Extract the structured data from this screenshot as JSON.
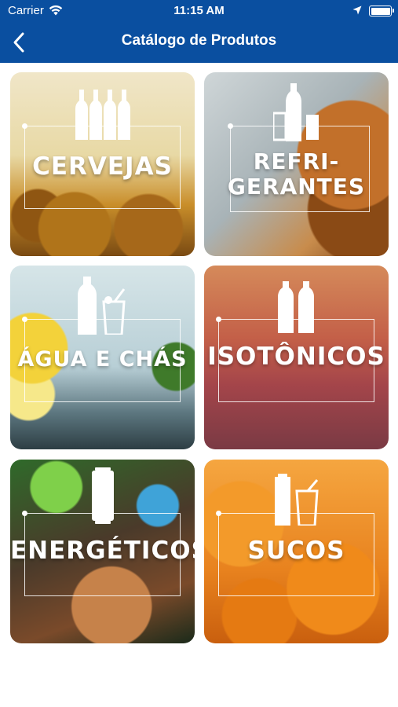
{
  "status_bar": {
    "carrier": "Carrier",
    "time": "11:15 AM"
  },
  "nav": {
    "title": "Catálogo de Produtos"
  },
  "categories": [
    {
      "label": "CERVEJAS",
      "icon": "beer-bottles-icon"
    },
    {
      "label_line1": "REFRI-",
      "label_line2": "GERANTES",
      "icon": "soda-bottle-glass-icon"
    },
    {
      "label": "ÁGUA E CHÁS",
      "icon": "water-bottle-glass-icon"
    },
    {
      "label": "ISOTÔNICOS",
      "icon": "sports-bottles-icon"
    },
    {
      "label": "ENERGÉTICOS",
      "icon": "energy-can-icon"
    },
    {
      "label": "SUCOS",
      "icon": "juice-bottle-glass-icon"
    }
  ],
  "colors": {
    "nav_background": "#0a4fa0",
    "nav_text": "#ffffff"
  }
}
